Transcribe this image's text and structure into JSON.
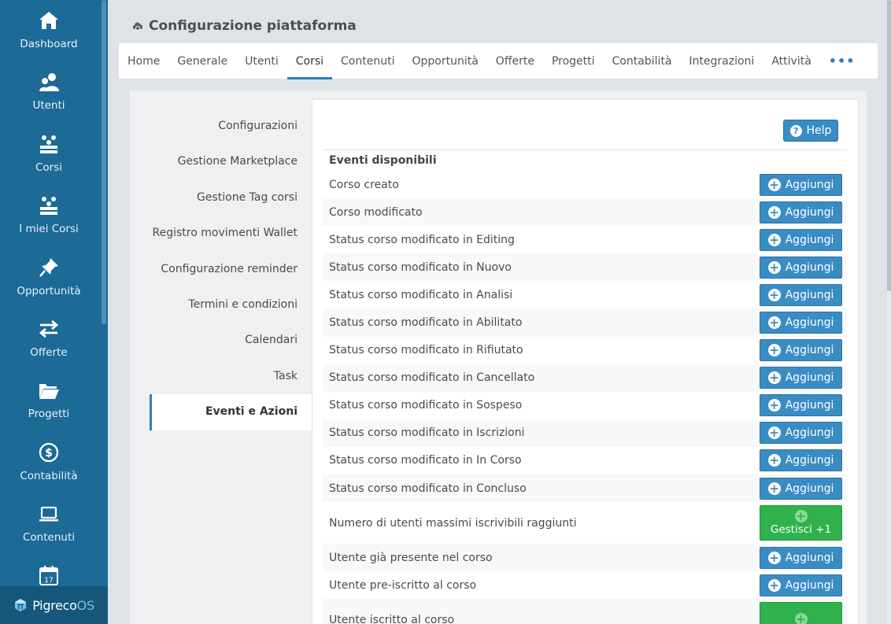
{
  "sidebar": {
    "items": [
      {
        "label": "Dashboard",
        "icon": "home-icon"
      },
      {
        "label": "Utenti",
        "icon": "users-icon"
      },
      {
        "label": "Corsi",
        "icon": "classroom-icon"
      },
      {
        "label": "I miei Corsi",
        "icon": "classroom-icon"
      },
      {
        "label": "Opportunità",
        "icon": "pin-icon"
      },
      {
        "label": "Offerte",
        "icon": "exchange-icon"
      },
      {
        "label": "Progetti",
        "icon": "folder-open-icon"
      },
      {
        "label": "Contabilità",
        "icon": "dollar-circle-icon"
      },
      {
        "label": "Contenuti",
        "icon": "laptop-icon"
      },
      {
        "label": "",
        "icon": "calendar-icon",
        "day": "17"
      }
    ],
    "brand": {
      "name": "Pigreco",
      "suffix": "OS"
    }
  },
  "header": {
    "title": "Configurazione piattaforma",
    "icon": "cloud-gear-icon"
  },
  "tabs": [
    {
      "label": "Home"
    },
    {
      "label": "Generale"
    },
    {
      "label": "Utenti"
    },
    {
      "label": "Corsi",
      "active": true
    },
    {
      "label": "Contenuti"
    },
    {
      "label": "Opportunità"
    },
    {
      "label": "Offerte"
    },
    {
      "label": "Progetti"
    },
    {
      "label": "Contabilità"
    },
    {
      "label": "Integrazioni"
    },
    {
      "label": "Attività"
    }
  ],
  "tabs_more": "•••",
  "submenu": [
    "Configurazioni",
    "Gestione Marketplace",
    "Gestione Tag corsi",
    "Registro movimenti Wallet",
    "Configurazione reminder",
    "Termini e condizioni",
    "Calendari",
    "Task",
    "Eventi e Azioni"
  ],
  "help": {
    "label": "Help"
  },
  "events": {
    "heading": "Eventi disponibili",
    "add_label": "Aggiungi",
    "rows": [
      {
        "label": "Corso creato",
        "action": "add"
      },
      {
        "label": "Corso modificato",
        "action": "add"
      },
      {
        "label": "Status corso modificato in Editing",
        "action": "add"
      },
      {
        "label": "Status corso modificato in Nuovo",
        "action": "add"
      },
      {
        "label": "Status corso modificato in Analisi",
        "action": "add"
      },
      {
        "label": "Status corso modificato in Abilitato",
        "action": "add"
      },
      {
        "label": "Status corso modificato in Rifiutato",
        "action": "add"
      },
      {
        "label": "Status corso modificato in Cancellato",
        "action": "add"
      },
      {
        "label": "Status corso modificato in Sospeso",
        "action": "add"
      },
      {
        "label": "Status corso modificato in Iscrizioni",
        "action": "add"
      },
      {
        "label": "Status corso modificato in In Corso",
        "action": "add"
      },
      {
        "label": "Status corso modificato in Concluso",
        "action": "add"
      },
      {
        "label": "Numero di utenti massimi iscrivibili raggiunti",
        "action": "manage",
        "manage_label": "Gestisci +1"
      },
      {
        "label": "Utente già presente nel corso",
        "action": "add"
      },
      {
        "label": "Utente pre-iscritto al corso",
        "action": "add"
      },
      {
        "label": "Utente iscritto al corso",
        "action": "manage",
        "manage_label": ""
      }
    ]
  },
  "colors": {
    "sidebar": "#1c6a96",
    "primary": "#3a8cc4",
    "success": "#2fb24c"
  }
}
